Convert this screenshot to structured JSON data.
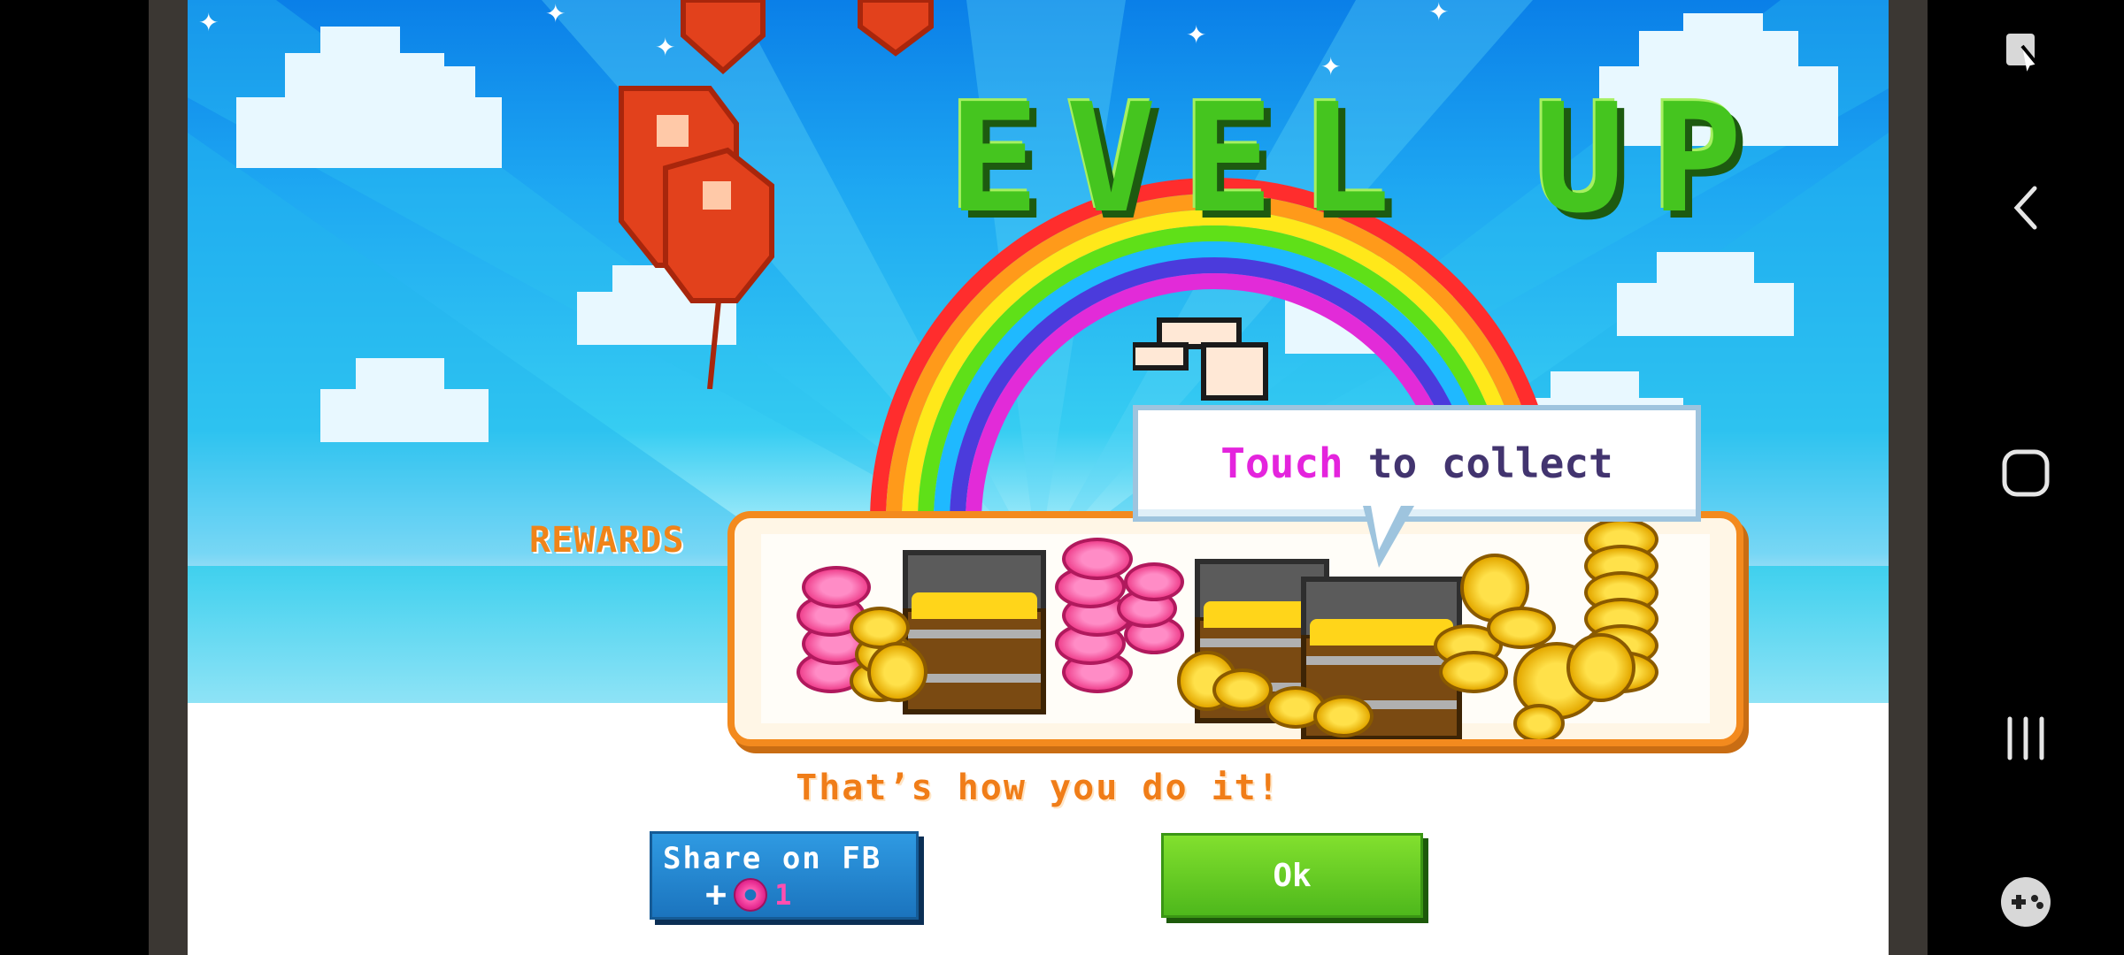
{
  "game": {
    "title": "EVEL UP",
    "bubble": {
      "highlight": "Touch",
      "rest": "to collect"
    },
    "rewards_label": "REWARDS",
    "message": "That’s how you do it!",
    "share_button": {
      "label": "Share on FB",
      "plus": "+",
      "count": "1",
      "icon": "donut-icon"
    },
    "ok_button": {
      "label": "Ok"
    }
  },
  "nav": {
    "items": [
      {
        "name": "game-tools-icon"
      },
      {
        "name": "back-icon"
      },
      {
        "name": "home-icon"
      },
      {
        "name": "recent-apps-icon"
      },
      {
        "name": "gamepad-icon"
      }
    ]
  },
  "colors": {
    "title_green": "#45c51f",
    "panel_orange": "#f38a1e",
    "touch_pink": "#e424dd",
    "fb_blue": "#1b74be",
    "ok_green": "#4eb81c"
  }
}
